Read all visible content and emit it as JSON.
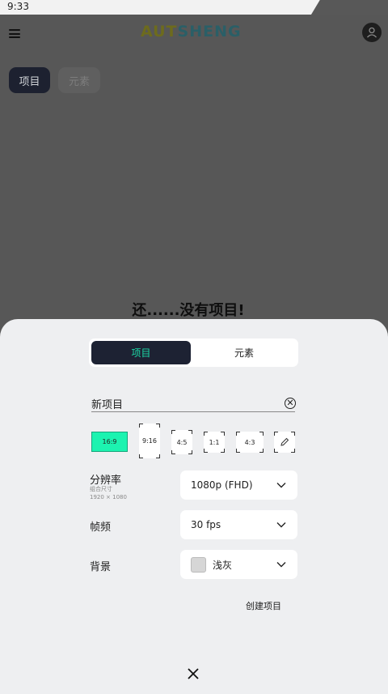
{
  "status_bar": {
    "time": "9:33"
  },
  "header": {
    "logo_part1": "AUT",
    "logo_part2": "SHENG"
  },
  "top_tabs": [
    {
      "label": "项目"
    },
    {
      "label": "元素"
    }
  ],
  "empty_state": {
    "message": "还......没有项目!"
  },
  "sheet": {
    "tabs": [
      {
        "label": "项目"
      },
      {
        "label": "元素"
      }
    ],
    "name_input": {
      "value": "新项目"
    },
    "ratios": [
      "16:9",
      "9:16",
      "4:5",
      "1:1",
      "4:3"
    ],
    "resolution": {
      "label": "分辨率",
      "sub1": "组合尺寸",
      "sub2": "1920 × 1080",
      "value": "1080p (FHD)"
    },
    "frame_rate": {
      "label": "帧频",
      "value": "30 fps"
    },
    "background": {
      "label": "背景",
      "value": "浅灰",
      "color": "#d6d6d6"
    },
    "create_label": "创建项目"
  },
  "colors": {
    "accent": "#1cf3b0",
    "dark": "#1d2233"
  },
  "icons": {
    "menu": "hamburger-menu-icon",
    "user": "user-icon",
    "clear": "clear-circle-icon",
    "edit": "pencil-icon",
    "chevron": "chevron-down-icon",
    "close": "close-icon"
  }
}
